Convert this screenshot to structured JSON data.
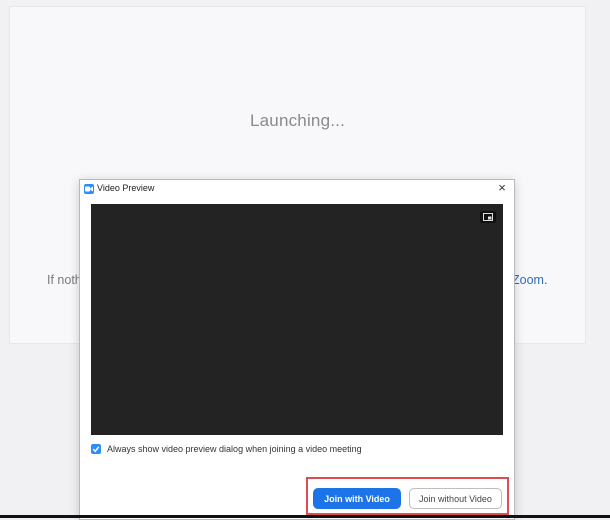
{
  "launch": {
    "title": "Launching...",
    "hint_left": "If noth",
    "hint_right": "Zoom."
  },
  "dialog": {
    "title": "Video Preview",
    "close_label": "×",
    "checkbox_label": "Always show video preview dialog when joining a video meeting",
    "checkbox_checked": true,
    "join_with_video": "Join with Video",
    "join_without_video": "Join without Video"
  },
  "colors": {
    "accent": "#1d73e8",
    "highlight": "#e04d50",
    "video_bg": "#232323"
  },
  "icons": {
    "app": "zoom-camera-icon",
    "close": "close-icon",
    "toggle": "picture-in-picture-icon",
    "check": "checkmark-icon"
  }
}
